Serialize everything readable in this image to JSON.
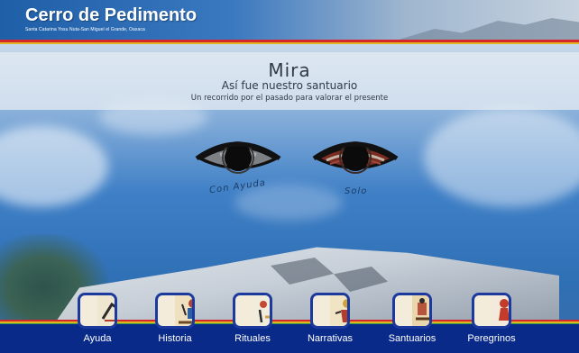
{
  "header": {
    "title": "Cerro de Pedimento",
    "subtitle": "Santa Catarina Yosu Nuta-San Miguel el Grande, Oaxaca"
  },
  "intro": {
    "heading": "Mira",
    "subheading": "Así fue nuestro santuario",
    "tagline": "Un recorrido por el pasado para valorar el presente"
  },
  "eyes": [
    {
      "label": "Con Ayuda",
      "icon": "eye-gray-icon"
    },
    {
      "label": "Solo",
      "icon": "eye-red-icon"
    }
  ],
  "nav": [
    {
      "label": "Ayuda",
      "icon": "help-codex-icon"
    },
    {
      "label": "Historia",
      "icon": "history-codex-icon"
    },
    {
      "label": "Rituales",
      "icon": "rituals-codex-icon"
    },
    {
      "label": "Narrativas",
      "icon": "narratives-codex-icon"
    },
    {
      "label": "Santuarios",
      "icon": "sanctuaries-codex-icon"
    },
    {
      "label": "Peregrinos",
      "icon": "pilgrims-codex-icon"
    }
  ],
  "colors": {
    "header_blue": "#1f5fa8",
    "bottom_bar": "#0a2a8a",
    "stripe_red": "#d7262b",
    "stripe_yellow": "#e0b51f",
    "stripe_green": "#3a9b48"
  }
}
